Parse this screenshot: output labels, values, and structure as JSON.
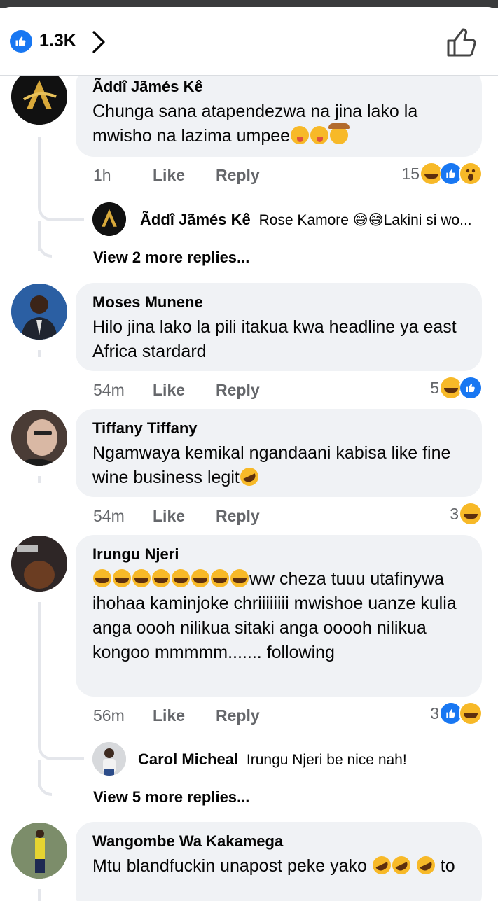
{
  "header": {
    "reaction_count": "1.3K"
  },
  "comments": [
    {
      "author": "Ãddî Jãmés Kê",
      "text": "Chunga sana atapendezwa na jina lako la mwisho na lazima umpee",
      "time": "1h",
      "like_label": "Like",
      "reply_label": "Reply",
      "reaction_count": "15",
      "reactions": [
        "haha-icon",
        "like-icon",
        "wow-icon"
      ],
      "reply_preview": {
        "author": "Ãddî Jãmés Kê",
        "text": "Rose Kamore 😅😅Lakini si wo..."
      },
      "view_more": "View 2 more replies..."
    },
    {
      "author": "Moses Munene",
      "text": "Hilo jina lako la pili itakua kwa headline ya east Africa stardard",
      "time": "54m",
      "like_label": "Like",
      "reply_label": "Reply",
      "reaction_count": "5",
      "reactions": [
        "haha-icon",
        "like-icon"
      ]
    },
    {
      "author": "Tiffany Tiffany",
      "text": "Ngamwaya kemikal ngandaani kabisa like fine wine business legit",
      "time": "54m",
      "like_label": "Like",
      "reply_label": "Reply",
      "reaction_count": "3",
      "reactions": [
        "haha-icon"
      ]
    },
    {
      "author": "Irungu Njeri",
      "text": "ww cheza tuuu utafinywa ihohaa kaminjoke chriiiiiiii mwishoe uanze kulia anga oooh nilikua sitaki anga ooooh nilikua kongoo mmmmm....... following",
      "time": "56m",
      "like_label": "Like",
      "reply_label": "Reply",
      "reaction_count": "3",
      "reactions": [
        "like-icon",
        "haha-icon"
      ],
      "reply_preview": {
        "author": "Carol Micheal",
        "text": "Irungu Njeri be nice nah!"
      },
      "view_more": "View 5 more replies..."
    },
    {
      "author": "Wangombe Wa Kakamega",
      "text": "Mtu blandfuckin unapost peke yako",
      "text_tail": "to"
    }
  ],
  "colors": {
    "accent": "#1877f2",
    "bubble": "#f0f2f5",
    "muted": "#65676b",
    "haha": "#f7b928"
  }
}
